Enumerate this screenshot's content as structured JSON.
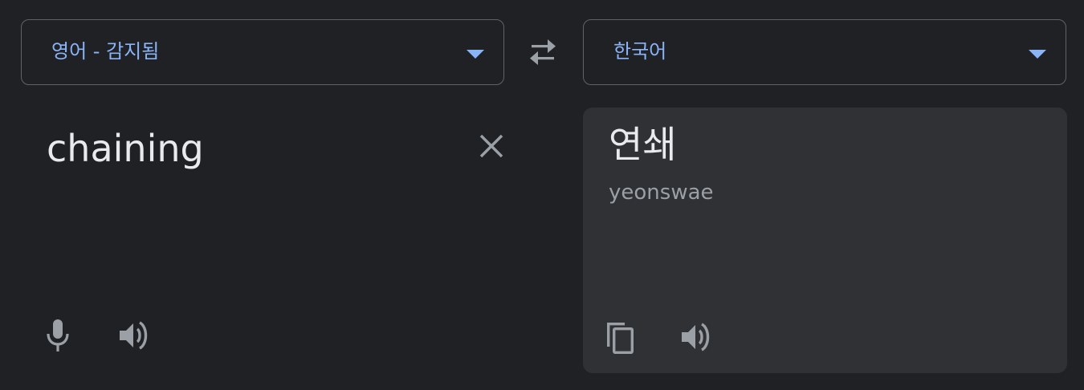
{
  "source_language": {
    "label": "영어 - 감지됨"
  },
  "target_language": {
    "label": "한국어"
  },
  "source": {
    "text": "chaining"
  },
  "target": {
    "text": "연쇄",
    "romanization": "yeonswae"
  },
  "icons": {
    "dropdown": "triangle-down-icon",
    "swap": "swap-arrows-icon",
    "clear": "close-icon",
    "microphone": "microphone-icon",
    "source_speaker": "speaker-icon",
    "copy": "copy-icon",
    "target_speaker": "speaker-icon"
  },
  "colors": {
    "background": "#202124",
    "accent": "#8ab4f8",
    "text_primary": "#e8eaed",
    "text_secondary": "#9aa0a6",
    "icon": "#9aa0a6",
    "panel": "#303134"
  }
}
